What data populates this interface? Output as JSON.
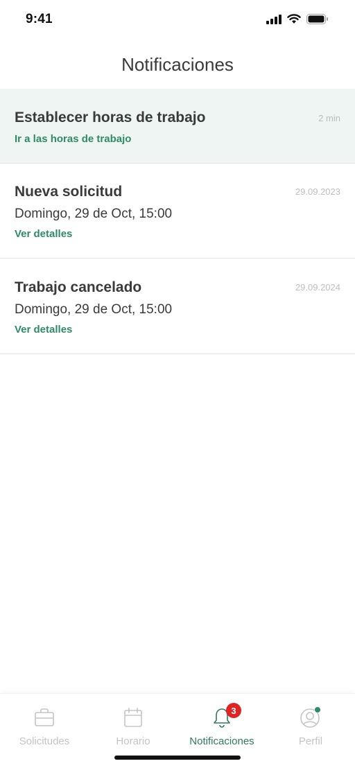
{
  "status_bar": {
    "time": "9:41"
  },
  "header": {
    "title": "Notificaciones"
  },
  "notifications": [
    {
      "title": "Establecer horas de trabajo",
      "time": "2 min",
      "subtitle": "",
      "link": "Ir a las horas de trabajo",
      "unread": true
    },
    {
      "title": "Nueva solicitud",
      "time": "29.09.2023",
      "subtitle": "Domingo, 29 de Oct, 15:00",
      "link": "Ver detalles",
      "unread": false
    },
    {
      "title": "Trabajo cancelado",
      "time": "29.09.2024",
      "subtitle": "Domingo, 29 de Oct, 15:00",
      "link": "Ver detalles",
      "unread": false
    }
  ],
  "tab_bar": {
    "tabs": [
      {
        "label": "Solicitudes",
        "icon": "briefcase-icon",
        "active": false
      },
      {
        "label": "Horario",
        "icon": "calendar-icon",
        "active": false
      },
      {
        "label": "Notificaciones",
        "icon": "bell-icon",
        "active": true,
        "badge": "3"
      },
      {
        "label": "Perfil",
        "icon": "profile-icon",
        "active": false,
        "dot": true
      }
    ]
  },
  "colors": {
    "accent": "#2f8a68",
    "badge": "#e02424",
    "unread_bg": "#eef5f2",
    "inactive": "#c4c4c4"
  }
}
